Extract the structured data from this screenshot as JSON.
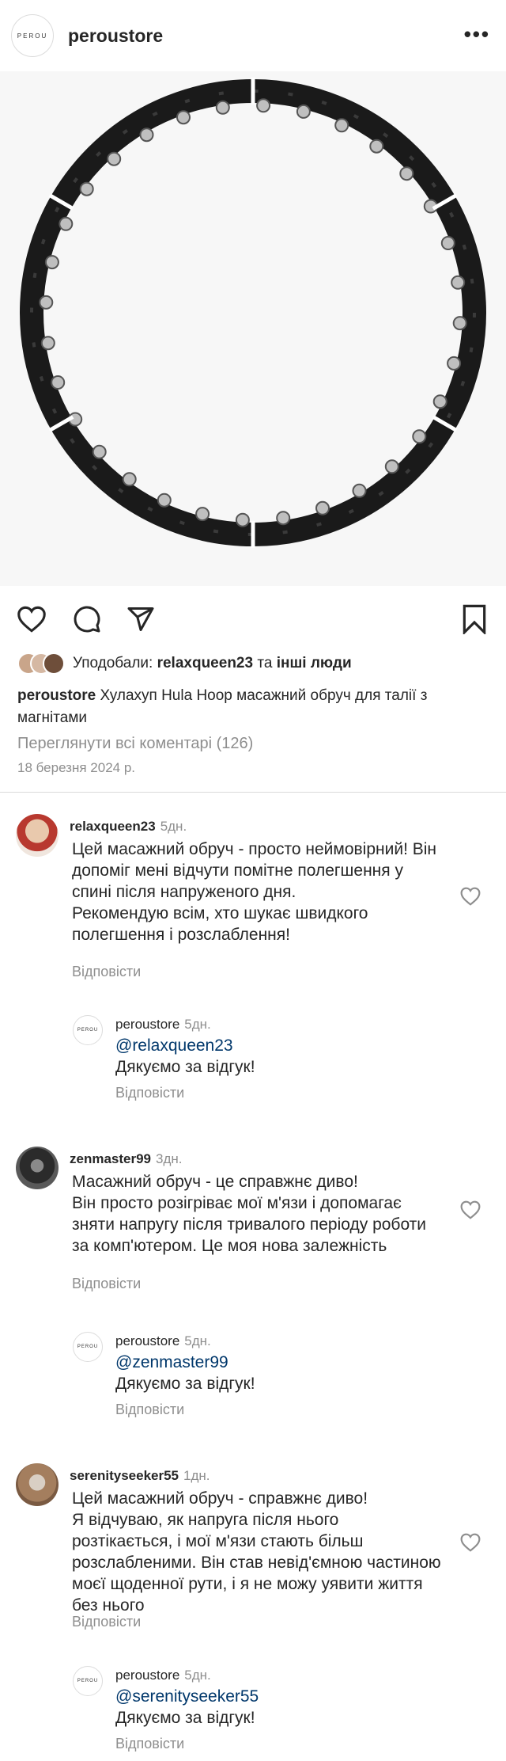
{
  "header": {
    "avatar_text": "PEROU",
    "username": "peroustore",
    "more_icon": "more-horizontal-icon"
  },
  "post": {
    "image_alt": "hula-hoop-product",
    "icons": [
      "heart-icon",
      "comment-icon",
      "share-icon",
      "bookmark-icon"
    ],
    "likes_prefix": "Уподобали:",
    "likes_user": "relaxqueen23",
    "likes_and": "та",
    "likes_others": "інші люди",
    "caption_user": "peroustore",
    "caption_text": "Хулахуп Hula Hoop масажний обруч для талії з магнітами",
    "view_all": "Переглянути всі коментарі (126)",
    "date": "18 березня 2024 р."
  },
  "comments": [
    {
      "user": "relaxqueen23",
      "time": "5дн.",
      "text": "Цей масажний обруч - просто неймовірний! Він допоміг мені відчути помітне полегшення у спині після напруженого дня.\nРекомендую всім, хто шукає швидкого полегшення і розслаблення!",
      "reply_label": "Відповісти",
      "response": {
        "user": "peroustore",
        "time": "5дн.",
        "mention": "@relaxqueen23",
        "text": "Дякуємо за відгук!",
        "reply_label": "Відповісти"
      }
    },
    {
      "user": "zenmaster99",
      "time": "3дн.",
      "text": "Масажний обруч - це справжнє диво!\nВін просто розігріває мої м'язи і допомагає зняти напругу після тривалого періоду роботи за комп'ютером. Це моя нова залежність",
      "reply_label": "Відповісти",
      "response": {
        "user": "peroustore",
        "time": "5дн.",
        "mention": "@zenmaster99",
        "text": "Дякуємо за відгук!",
        "reply_label": "Відповісти"
      }
    },
    {
      "user": "serenityseeker55",
      "time": "1дн.",
      "text": "Цей масажний обруч - справжнє диво!\nЯ відчуваю, як напруга після нього розтікається, і мої м'язи стають більш розслабленими. Він став невід'ємною частиною моєї щоденної рути, і я не можу уявити життя без нього",
      "reply_label": "Відповісти",
      "response": {
        "user": "peroustore",
        "time": "5дн.",
        "mention": "@serenityseeker55",
        "text": "Дякуємо за відгук!",
        "reply_label": "Відповісти"
      }
    }
  ]
}
